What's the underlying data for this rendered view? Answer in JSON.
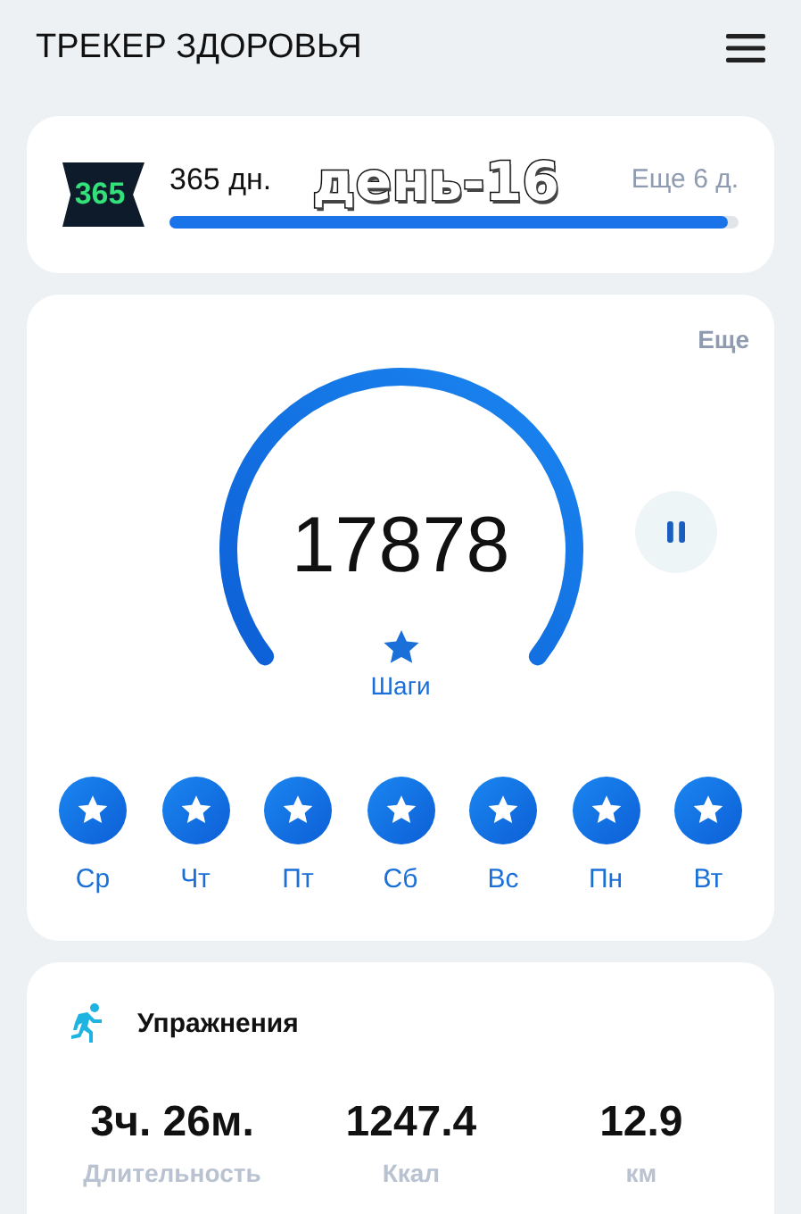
{
  "header": {
    "title": "ТРЕКЕР ЗДОРОВЬЯ"
  },
  "plan": {
    "logo": "365",
    "title": "365 дн.",
    "remaining": "Еще 6 д.",
    "level": 0.98,
    "overlay": "день-16"
  },
  "steps": {
    "more": "Еще",
    "count": "17878",
    "label": "Шаги"
  },
  "days": [
    {
      "label": "Ср",
      "done": true
    },
    {
      "label": "Чт",
      "done": true
    },
    {
      "label": "Пт",
      "done": true
    },
    {
      "label": "Сб",
      "done": true
    },
    {
      "label": "Вс",
      "done": true
    },
    {
      "label": "Пн",
      "done": true
    },
    {
      "label": "Вт",
      "done": true
    }
  ],
  "exercise": {
    "title": "Упражнения",
    "stats": [
      {
        "value": "3ч. 26м.",
        "label": "Длительность"
      },
      {
        "value": "1247.4",
        "label": "Ккал"
      },
      {
        "value": "12.9",
        "label": "км"
      }
    ]
  }
}
